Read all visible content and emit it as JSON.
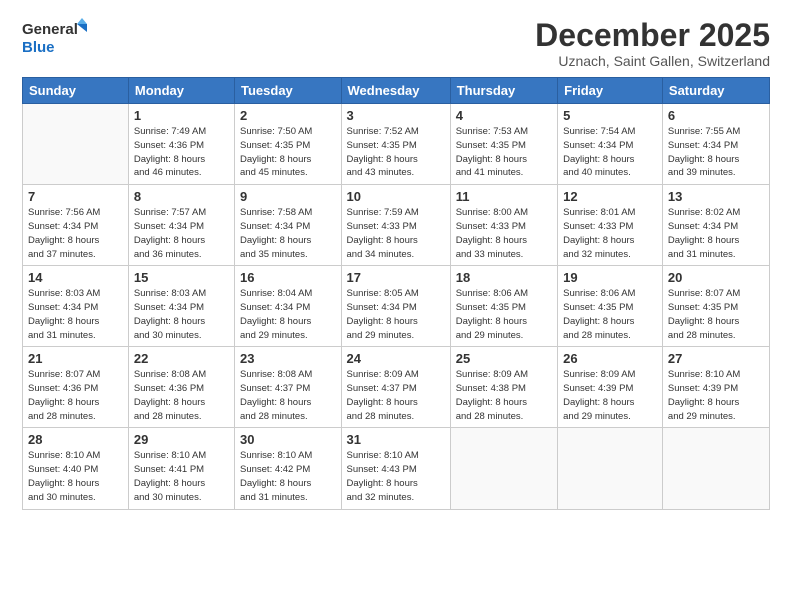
{
  "header": {
    "logo_line1": "General",
    "logo_line2": "Blue",
    "title": "December 2025",
    "subtitle": "Uznach, Saint Gallen, Switzerland"
  },
  "days_of_week": [
    "Sunday",
    "Monday",
    "Tuesday",
    "Wednesday",
    "Thursday",
    "Friday",
    "Saturday"
  ],
  "weeks": [
    [
      {
        "day": "",
        "info": ""
      },
      {
        "day": "1",
        "info": "Sunrise: 7:49 AM\nSunset: 4:36 PM\nDaylight: 8 hours\nand 46 minutes."
      },
      {
        "day": "2",
        "info": "Sunrise: 7:50 AM\nSunset: 4:35 PM\nDaylight: 8 hours\nand 45 minutes."
      },
      {
        "day": "3",
        "info": "Sunrise: 7:52 AM\nSunset: 4:35 PM\nDaylight: 8 hours\nand 43 minutes."
      },
      {
        "day": "4",
        "info": "Sunrise: 7:53 AM\nSunset: 4:35 PM\nDaylight: 8 hours\nand 41 minutes."
      },
      {
        "day": "5",
        "info": "Sunrise: 7:54 AM\nSunset: 4:34 PM\nDaylight: 8 hours\nand 40 minutes."
      },
      {
        "day": "6",
        "info": "Sunrise: 7:55 AM\nSunset: 4:34 PM\nDaylight: 8 hours\nand 39 minutes."
      }
    ],
    [
      {
        "day": "7",
        "info": "Sunrise: 7:56 AM\nSunset: 4:34 PM\nDaylight: 8 hours\nand 37 minutes."
      },
      {
        "day": "8",
        "info": "Sunrise: 7:57 AM\nSunset: 4:34 PM\nDaylight: 8 hours\nand 36 minutes."
      },
      {
        "day": "9",
        "info": "Sunrise: 7:58 AM\nSunset: 4:34 PM\nDaylight: 8 hours\nand 35 minutes."
      },
      {
        "day": "10",
        "info": "Sunrise: 7:59 AM\nSunset: 4:33 PM\nDaylight: 8 hours\nand 34 minutes."
      },
      {
        "day": "11",
        "info": "Sunrise: 8:00 AM\nSunset: 4:33 PM\nDaylight: 8 hours\nand 33 minutes."
      },
      {
        "day": "12",
        "info": "Sunrise: 8:01 AM\nSunset: 4:33 PM\nDaylight: 8 hours\nand 32 minutes."
      },
      {
        "day": "13",
        "info": "Sunrise: 8:02 AM\nSunset: 4:34 PM\nDaylight: 8 hours\nand 31 minutes."
      }
    ],
    [
      {
        "day": "14",
        "info": "Sunrise: 8:03 AM\nSunset: 4:34 PM\nDaylight: 8 hours\nand 31 minutes."
      },
      {
        "day": "15",
        "info": "Sunrise: 8:03 AM\nSunset: 4:34 PM\nDaylight: 8 hours\nand 30 minutes."
      },
      {
        "day": "16",
        "info": "Sunrise: 8:04 AM\nSunset: 4:34 PM\nDaylight: 8 hours\nand 29 minutes."
      },
      {
        "day": "17",
        "info": "Sunrise: 8:05 AM\nSunset: 4:34 PM\nDaylight: 8 hours\nand 29 minutes."
      },
      {
        "day": "18",
        "info": "Sunrise: 8:06 AM\nSunset: 4:35 PM\nDaylight: 8 hours\nand 29 minutes."
      },
      {
        "day": "19",
        "info": "Sunrise: 8:06 AM\nSunset: 4:35 PM\nDaylight: 8 hours\nand 28 minutes."
      },
      {
        "day": "20",
        "info": "Sunrise: 8:07 AM\nSunset: 4:35 PM\nDaylight: 8 hours\nand 28 minutes."
      }
    ],
    [
      {
        "day": "21",
        "info": "Sunrise: 8:07 AM\nSunset: 4:36 PM\nDaylight: 8 hours\nand 28 minutes."
      },
      {
        "day": "22",
        "info": "Sunrise: 8:08 AM\nSunset: 4:36 PM\nDaylight: 8 hours\nand 28 minutes."
      },
      {
        "day": "23",
        "info": "Sunrise: 8:08 AM\nSunset: 4:37 PM\nDaylight: 8 hours\nand 28 minutes."
      },
      {
        "day": "24",
        "info": "Sunrise: 8:09 AM\nSunset: 4:37 PM\nDaylight: 8 hours\nand 28 minutes."
      },
      {
        "day": "25",
        "info": "Sunrise: 8:09 AM\nSunset: 4:38 PM\nDaylight: 8 hours\nand 28 minutes."
      },
      {
        "day": "26",
        "info": "Sunrise: 8:09 AM\nSunset: 4:39 PM\nDaylight: 8 hours\nand 29 minutes."
      },
      {
        "day": "27",
        "info": "Sunrise: 8:10 AM\nSunset: 4:39 PM\nDaylight: 8 hours\nand 29 minutes."
      }
    ],
    [
      {
        "day": "28",
        "info": "Sunrise: 8:10 AM\nSunset: 4:40 PM\nDaylight: 8 hours\nand 30 minutes."
      },
      {
        "day": "29",
        "info": "Sunrise: 8:10 AM\nSunset: 4:41 PM\nDaylight: 8 hours\nand 30 minutes."
      },
      {
        "day": "30",
        "info": "Sunrise: 8:10 AM\nSunset: 4:42 PM\nDaylight: 8 hours\nand 31 minutes."
      },
      {
        "day": "31",
        "info": "Sunrise: 8:10 AM\nSunset: 4:43 PM\nDaylight: 8 hours\nand 32 minutes."
      },
      {
        "day": "",
        "info": ""
      },
      {
        "day": "",
        "info": ""
      },
      {
        "day": "",
        "info": ""
      }
    ]
  ]
}
